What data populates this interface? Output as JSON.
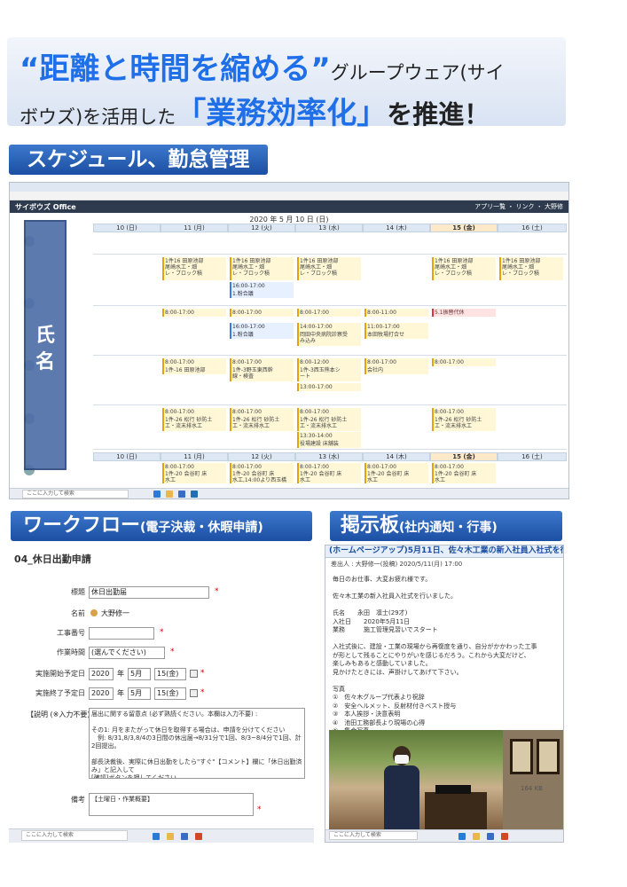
{
  "headline": {
    "quote_phrase": "“距離と時間を縮める”",
    "rest_line1": "グループウェア(サイ",
    "line2_start": "ボウズ)を活用した",
    "emphasis": "「業務効率化」",
    "line2_end": "を推進！"
  },
  "sections": {
    "schedule": {
      "title": "スケジュール、勤怠管理"
    },
    "workflow": {
      "title": "ワークフロー",
      "subtitle": "(電子決裁・休暇申請)"
    },
    "bulletin": {
      "title": "掲示板",
      "subtitle": "(社内通知・行事)"
    }
  },
  "schedule_screen": {
    "app_logo": "サイボウズ Office",
    "menu": "アプリ一覧 ・ リンク ・ 大野修",
    "date_heading": "2020 年 5 月 10 日 (日)",
    "name_overlay": [
      "氏",
      "名"
    ],
    "days": [
      "10 (日)",
      "11 (月)",
      "12 (火)",
      "13 (水)",
      "14 (木)",
      "15 (金)",
      "16 (土)"
    ],
    "days_week2": [
      "10 (日)",
      "11 (月)",
      "12 (火)",
      "13 (水)",
      "14 (木)",
      "15 (金)",
      "16 (土)"
    ],
    "events": {
      "e1": "1件16 田原池部\n尾崎水工・畑\nレ・ブロック積",
      "e2": "1件16 田原池部\n尾崎水工・畑\nレ・ブロック積",
      "e3": "1件16 田原池部\n尾崎水工・畑\nレ・ブロック積",
      "e4": "1件16 田原池部\n尾崎水工・畑\nレ・ブロック積",
      "e5": "1件16 田原池部\n尾崎水工・畑\nレ・ブロック積",
      "t1": "16:00-17:00",
      "t1b": "1.粉合議",
      "r1": "8:00-17:00",
      "r2": "8:00-17:00",
      "r3": "8:00-17:00",
      "r4": "8:00-11:00",
      "r5": "5.1振替代休",
      "r6": "16:00-17:00",
      "r6b": "1.粉合議",
      "r7": "14:00-17:00",
      "r7b": "岡田中央病院診察受\nみ込み",
      "r8": "11:00-17:00",
      "r8b": "本田牧場打合せ",
      "a1": "8:00-17:00",
      "a1b": "1件-16 田原池部",
      "a2": "8:00-17:00",
      "a2b": "1件-3野玉東西幹\n線・検査",
      "a3": "8:00-12:00",
      "a3b": "1件-3西玉熊本シ\nート",
      "a3c": "13:00-17:00",
      "a4": "8:00-17:00",
      "a4b": "会社内",
      "a5": "8:00-17:00",
      "b1": "8:00-17:00",
      "b1b": "1件-26 松行 砂防土\n工・流末排水工",
      "b2": "8:00-17:00",
      "b2b": "1件-26 松行 砂防土\n工・流末排水工",
      "b3": "8:00-17:00",
      "b3b": "1件-26 松行 砂防土\n工・流末排水工",
      "b3c": "13:30-14:00",
      "b3d": "役場建設 床舗装",
      "b4": "8:00-17:00",
      "b4b": "1件-26 松行 砂防土\n工・流末排水工",
      "c1": "8:00-17:00",
      "c1b": "1件-20 会谷町 床\n水工",
      "c2": "8:00-17:00",
      "c2b": "1件-20 会谷町 床\n水工,14:00より西玉橋",
      "c3": "8:00-17:00",
      "c3b": "1件-20 会谷町 床\n水工",
      "c4": "8:00-17:00",
      "c4b": "1件-20 会谷町 床\n水工",
      "c5": "8:00-17:00",
      "c5b": "1件-20 会谷町 床\n水工"
    },
    "taskbar_search": "ここに入力して検索"
  },
  "workflow_screen": {
    "form_title": "04_休日出勤申請",
    "fields": {
      "subject_label": "標題",
      "subject_value": "休日出勤届",
      "name_label": "名前",
      "name_value": "大野修一",
      "project_label": "工事番号",
      "work_label": "作業時間",
      "work_value": "(選んでください)",
      "start_label": "実施開始予定日",
      "end_label": "実施終了予定日",
      "year": "2020",
      "month": "5月",
      "day": "15(金)",
      "nen": "年",
      "desc_label": "【説明 (※入力不要)】",
      "desc_text": "届出に関する留意点 (必ず熟読ください。本欄は入力不要) :\n\nその1: 月をまたがって休日を取得する場合は、申請を分けてください\n　例: 8/31,8/3,8/4の3日間の休出届→8/31分で1回、8/3~8/4分で1回、計2回提出。\n\n部長決裁後、実際に休日出勤をしたら\"すぐ\"【コメント】欄に「休日出勤済み」と記入して\n[確認]ボタンを押してください。\n休出予定をせず実施を取り止めた場合は、【コメント】欄に「取り下げ」と記入して\n[確認]ボタンを押してください。",
      "note_label": "備考",
      "note_value": "【土曜日・作業概要】"
    },
    "taskbar_search": "ここに入力して検索"
  },
  "bulletin_screen": {
    "header": "(ホームページアップ)5月11日、佐々木工業の新入社員入社式を行いまし",
    "sub": "差出人 : 大野修一(投稿) 2020/5/11(月) 17:00",
    "body": [
      "毎日のお仕事、大変お疲れ様です。",
      "",
      "佐々木工業の新入社員入社式を行いました。",
      "",
      "氏名　　永田　凛士(29才)",
      "入社日　　2020年5月11日",
      "業務　　　施工管理見習いでスタート",
      "",
      "入社式後に、建設・工業の現場から再復度を通り、自分がかかわった工事",
      "が形として残ることにやりがいを感じるだろう。これから大変だけど、",
      "楽しみもあると感動していました。",
      "見かけたときには、声掛けしてあげて下さい。",
      "",
      "写真",
      "①　佐々木グループ代表より祝辞",
      "②　安全ヘルメット、反射材付きベスト授与",
      "③　本人挨拶・決意表明",
      "④　池田工務部長より現場の心得",
      "⑤　集合写真"
    ],
    "file_size": "164 KB",
    "taskbar_search": "ここに入力して検索"
  }
}
